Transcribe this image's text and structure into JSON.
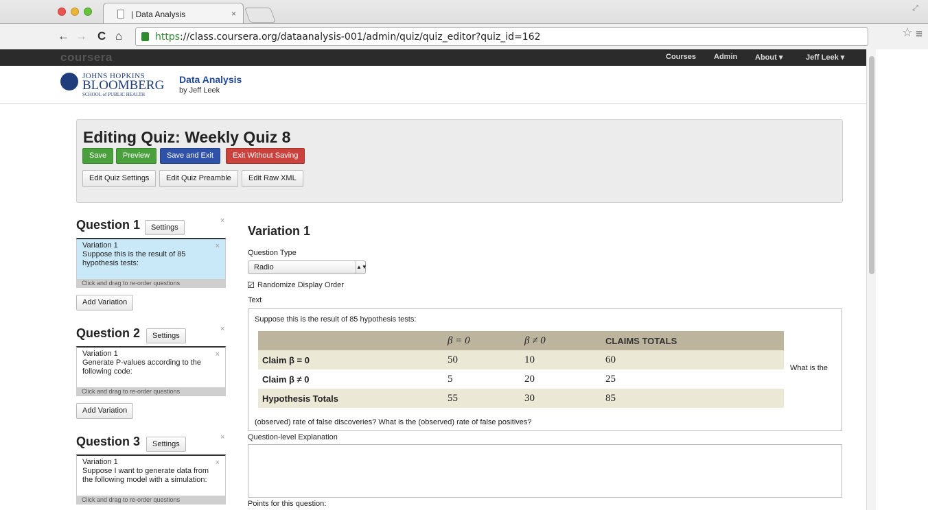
{
  "browser": {
    "tab_title": "| Data Analysis",
    "tab_close": "×",
    "url_https": "https",
    "url_rest": "://class.coursera.org/dataanalysis-001/admin/quiz/quiz_editor?quiz_id=162",
    "back_glyph": "←",
    "forward_glyph": "→",
    "reload_glyph": "C",
    "home_glyph": "⌂",
    "star_glyph": "☆",
    "menu_glyph": "≡",
    "resize_glyph": "⤢"
  },
  "site_nav": {
    "logo": "coursera",
    "items": [
      "Courses",
      "Admin",
      "About ▾",
      "Jeff Leek ▾"
    ]
  },
  "course": {
    "school_line1": "JOHNS HOPKINS",
    "school_line2": "BLOOMBERG",
    "school_line3": "SCHOOL of PUBLIC HEALTH",
    "title": "Data Analysis",
    "byline": "by Jeff Leek"
  },
  "editor": {
    "title": "Editing Quiz: Weekly Quiz 8",
    "save": "Save",
    "preview": "Preview",
    "save_exit": "Save and Exit",
    "exit_no_save": "Exit Without Saving",
    "edit_settings": "Edit Quiz Settings",
    "edit_preamble": "Edit Quiz Preamble",
    "edit_xml": "Edit Raw XML"
  },
  "questions": [
    {
      "title": "Question 1",
      "settings": "Settings",
      "close": "×",
      "var_title": "Variation 1",
      "var_text": "Suppose this is the result of 85 hypothesis tests:",
      "drag": "Click and drag to re-order questions",
      "add": "Add Variation"
    },
    {
      "title": "Question 2",
      "settings": "Settings",
      "close": "×",
      "var_title": "Variation 1",
      "var_text": "Generate P-values according to the following code:",
      "drag": "Click and drag to re-order questions",
      "add": "Add Variation"
    },
    {
      "title": "Question 3",
      "settings": "Settings",
      "close": "×",
      "var_title": "Variation 1",
      "var_text": "Suppose I want to generate data from the following model with a simulation:",
      "drag": "Click and drag to re-order questions"
    }
  ],
  "variation": {
    "title": "Variation 1",
    "qtype_label": "Question Type",
    "qtype_value": "Radio",
    "randomize_label": "Randomize Display Order",
    "randomize_checked": true,
    "text_label": "Text",
    "text_intro": "Suppose this is the result of 85 hypothesis tests:",
    "text_what": "What is the",
    "text_outro": "(observed) rate of false discoveries? What is the (observed) rate of false positives?",
    "table": {
      "header": [
        "",
        "β = 0",
        "β ≠ 0",
        "CLAIMS TOTALS"
      ],
      "rows": [
        [
          "Claim β = 0",
          "50",
          "10",
          "60"
        ],
        [
          "Claim β ≠ 0",
          "5",
          "20",
          "25"
        ],
        [
          "Hypothesis Totals",
          "55",
          "30",
          "85"
        ]
      ]
    },
    "explanation_label": "Question-level Explanation",
    "points_label": "Points for this question:"
  }
}
